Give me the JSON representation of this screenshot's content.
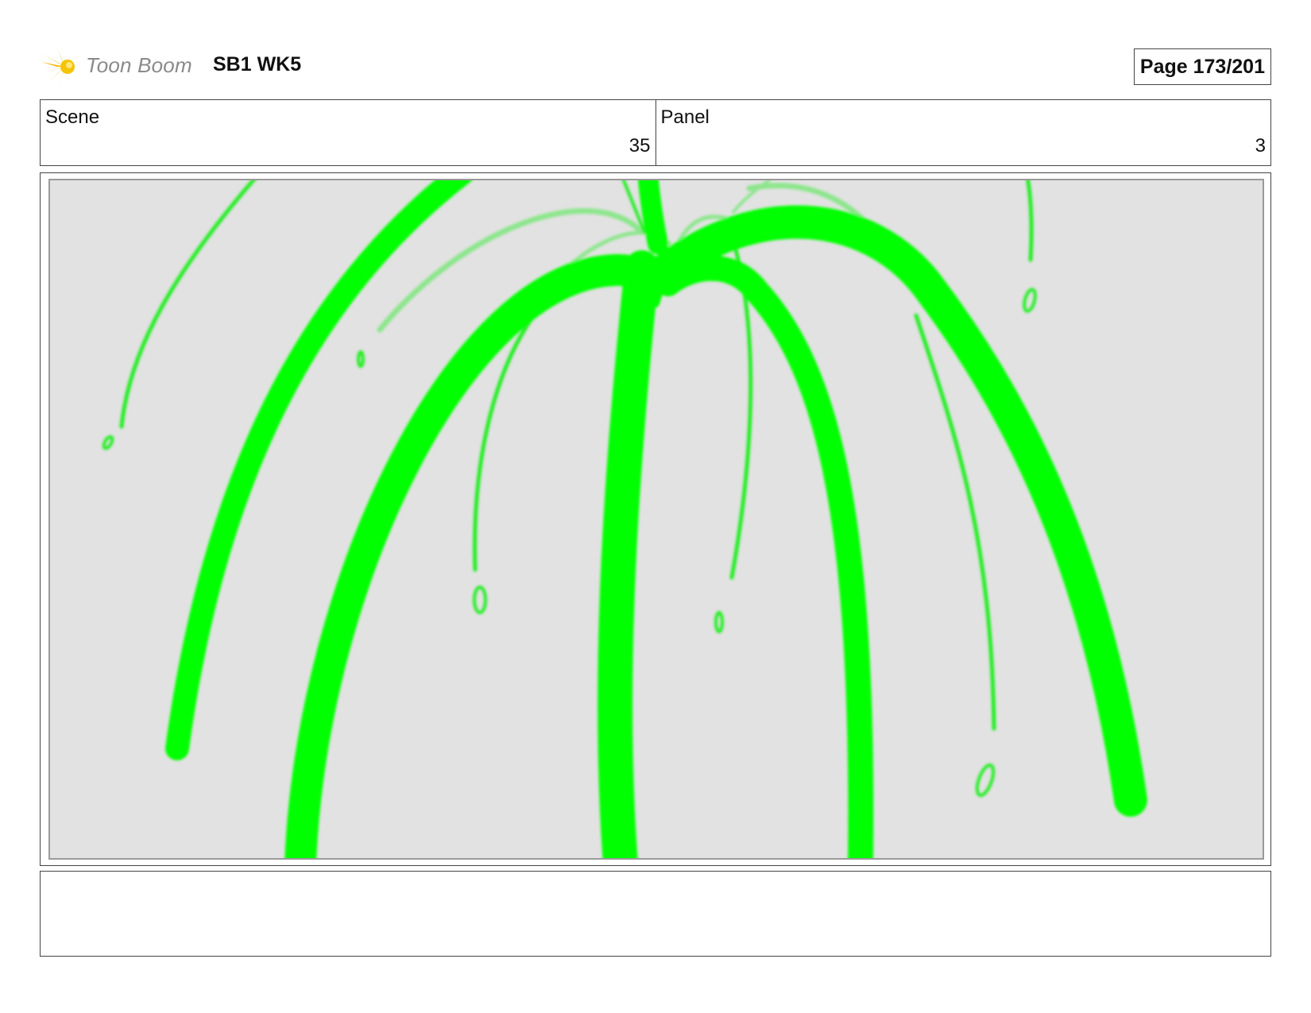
{
  "header": {
    "brand": "Toon Boom",
    "project": "SB1 WK5",
    "page": "Page 173/201"
  },
  "info": {
    "scene_label": "Scene",
    "scene_value": "35",
    "panel_label": "Panel",
    "panel_value": "3"
  },
  "artwork": {
    "description_icon": "fountain-splash",
    "stroke_color": "#00ff00",
    "light_stroke_color": "#66ee66",
    "background_color": "#e2e2e2"
  },
  "notes": {
    "text": ""
  }
}
